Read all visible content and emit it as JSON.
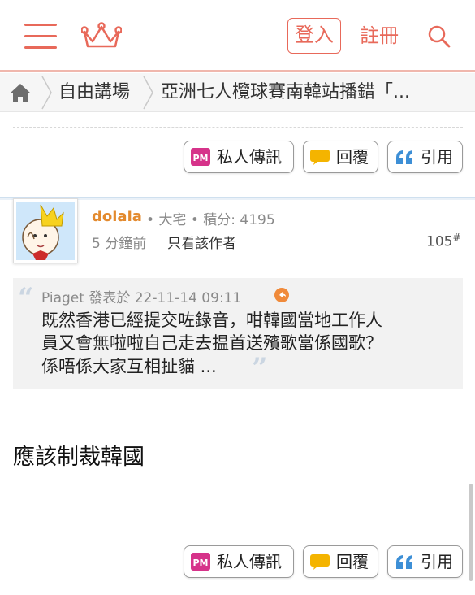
{
  "header": {
    "login_label": "登入",
    "register_label": "註冊"
  },
  "breadcrumb": {
    "forum": "自由講場",
    "thread_title": "亞洲七人欖球賽南韓站播錯「..."
  },
  "actions": {
    "pm_label": "私人傳訊",
    "reply_label": "回覆",
    "quote_label": "引用"
  },
  "post": {
    "username": "dolala",
    "user_meta": "• 大宅 • 積分: 4195",
    "time": "5 分鐘前",
    "only_author": "只看該作者",
    "floor": "105",
    "floor_mark": "#",
    "quote": {
      "author_meta": "Piaget 發表於 22-11-14 09:11",
      "lines": [
        "既然香港已經提交咗錄音，咁韓國當地工作人",
        "員又會無啦啦自己走去揾首送殯歌當係國歌？",
        "係唔係大家互相扯貓 ..."
      ]
    },
    "body": "應該制裁韓國"
  },
  "icons": {
    "pm_icon_text": "PM"
  },
  "colors": {
    "accent": "#e8695a",
    "username": "#e38a2e",
    "pm": "#d6338a",
    "reply": "#f4b400",
    "quote": "#3d8fd6"
  }
}
